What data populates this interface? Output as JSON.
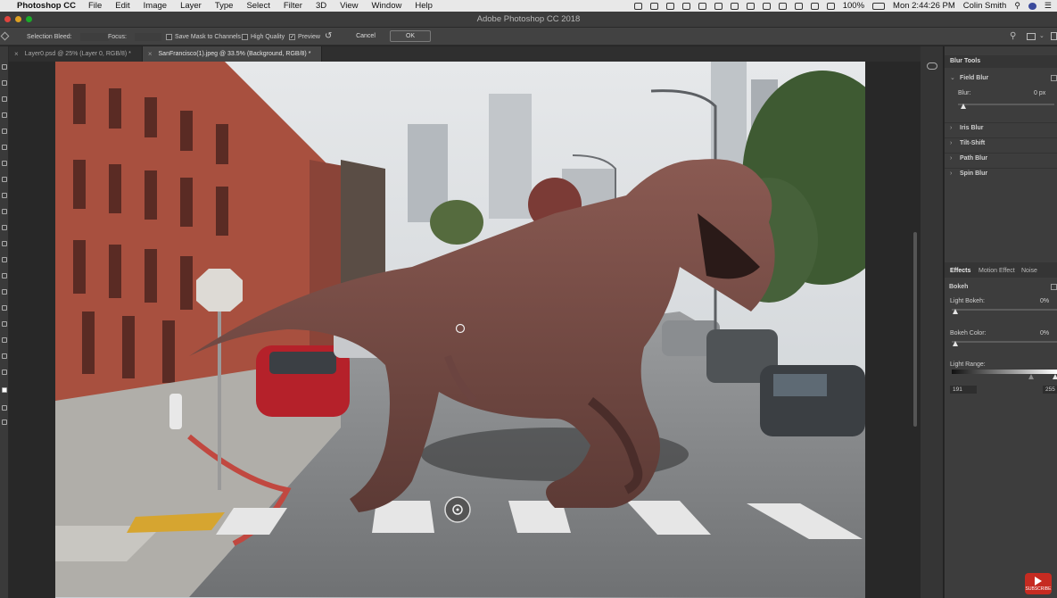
{
  "menubar": {
    "app_name": "Photoshop CC",
    "items": [
      "File",
      "Edit",
      "Image",
      "Layer",
      "Type",
      "Select",
      "Filter",
      "3D",
      "View",
      "Window",
      "Help"
    ],
    "battery": "100%",
    "clock": "Mon 2:44:26 PM",
    "user": "Colin Smith"
  },
  "window": {
    "title": "Adobe Photoshop CC 2018"
  },
  "options": {
    "selection_bleed_label": "Selection Bleed:",
    "focus_label": "Focus:",
    "save_mask_label": "Save Mask to Channels",
    "high_quality_label": "High Quality",
    "preview_label": "Preview",
    "preview_checked": true,
    "cancel_label": "Cancel",
    "ok_label": "OK"
  },
  "tabs": [
    {
      "label": "Layer0.psd @ 25% (Layer 0, RGB/8) *",
      "active": false
    },
    {
      "label": "SanFrancisco(1).jpeg @ 33.5% (Background, RGB/8) *",
      "active": true
    }
  ],
  "blur_tools": {
    "header": "Blur Tools",
    "field_blur": {
      "label": "Field Blur",
      "blur_label": "Blur:",
      "blur_value": "0 px"
    },
    "collapsed": [
      "Iris Blur",
      "Tilt-Shift",
      "Path Blur",
      "Spin Blur"
    ]
  },
  "effects": {
    "tabs": [
      "Effects",
      "Motion Effect",
      "Noise"
    ],
    "bokeh_label": "Bokeh",
    "light_bokeh_label": "Light Bokeh:",
    "light_bokeh_value": "0%",
    "bokeh_color_label": "Bokeh Color:",
    "bokeh_color_value": "0%",
    "light_range_label": "Light Range:",
    "light_range_low": "191",
    "light_range_high": "255"
  },
  "watermark": {
    "subscribe": "SUBSCRIBE"
  },
  "colors": {
    "accent": "#3d3d3d",
    "menubar": "#e8e8e8",
    "youtube": "#c62b21"
  }
}
